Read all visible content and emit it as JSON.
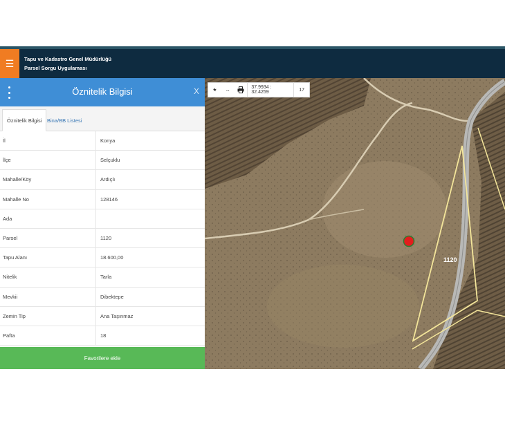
{
  "header": {
    "menu_icon": "hamburger-icon",
    "brand_line1": "Tapu ve Kadastro Genel Müdürlüğü",
    "brand_line2": "Parsel Sorgu Uygulaması",
    "accent": "#f07c22",
    "bg": "#0e2b40"
  },
  "panel": {
    "title": "Öznitelik Bilgisi",
    "close": "X",
    "tabs": [
      {
        "label": "Öznitelik Bilgisi",
        "active": true
      },
      {
        "label": "Bina/BB Listesi",
        "active": false
      }
    ],
    "rows": [
      {
        "key": "İl",
        "value": "Konya"
      },
      {
        "key": "İlçe",
        "value": "Selçuklu"
      },
      {
        "key": "Mahalle/Köy",
        "value": "Ardıçlı"
      },
      {
        "key": "Mahalle No",
        "value": "128146"
      },
      {
        "key": "Ada",
        "value": ""
      },
      {
        "key": "Parsel",
        "value": "1120"
      },
      {
        "key": "Tapu Alanı",
        "value": "18.600,00"
      },
      {
        "key": "Nitelik",
        "value": "Tarla"
      },
      {
        "key": "Mevkii",
        "value": "Dibektepe"
      },
      {
        "key": "Zemin Tip",
        "value": "Ana Taşınmaz"
      },
      {
        "key": "Pafta",
        "value": "18"
      }
    ],
    "favorite_button": "Favorilere ekle",
    "header_color": "#3f8ed6",
    "button_color": "#58b957"
  },
  "map": {
    "toolbar": {
      "star_icon": "star-icon",
      "measure_icon": "measure-icon",
      "print_icon": "print-icon",
      "coordinates": "37.9934 : 32.4259",
      "zoom": "17"
    },
    "parcel_label": "1120",
    "parcel_color": "#f3e59a",
    "marker_color": "#e31d1d"
  }
}
